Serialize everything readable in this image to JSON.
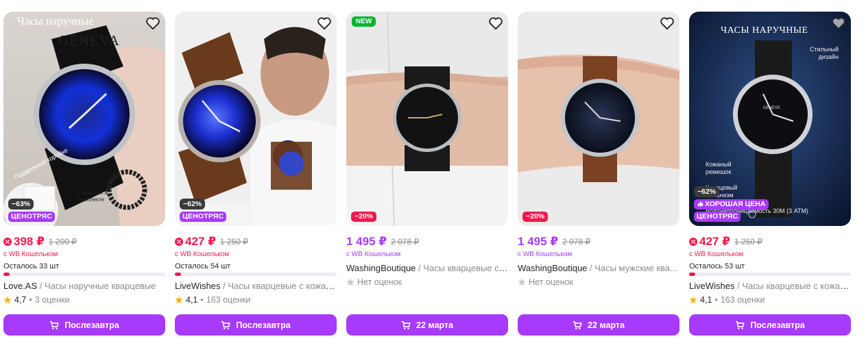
{
  "colors": {
    "accent": "#a73afd",
    "sale": "#f5174c",
    "muted": "#8b8b8b",
    "new": "#00b52b"
  },
  "icons": {
    "favorite": "heart-icon",
    "cart": "cart-icon",
    "star": "star-icon",
    "sale": "sale-icon"
  },
  "cards": [
    {
      "image_text": {
        "line1": "Часы наручные",
        "logo": "GENEVA",
        "box": "Подарочной коробке",
        "bracelet": "+ Браслет в комплекте"
      },
      "discount": "−63%",
      "cheap_badge": "ЦЕНОТРЯС",
      "price": "398 ₽",
      "old_price": "1 200 ₽",
      "wallet": "с WB Кошельком",
      "stock": "Осталось 33 шт",
      "stock_fraction": 0.04,
      "brand": "Love.AS",
      "sep": " / ",
      "name": "Часы наручные кварцевые",
      "rating": "4,7",
      "reviews": "3 оценки",
      "button": "Послезавтра"
    },
    {
      "discount": "−62%",
      "cheap_badge": "ЦЕНОТРЯС",
      "price": "427 ₽",
      "old_price": "1 250 ₽",
      "wallet": "с WB Кошельком",
      "stock": "Осталось 54 шт",
      "stock_fraction": 0.04,
      "brand": "LiveWishes",
      "sep": " / ",
      "name": "Часы кварцевые с кожан...",
      "rating": "4,1",
      "reviews": "163 оценки",
      "button": "Послезавтра"
    },
    {
      "new_badge": "NEW",
      "discount": "−20%",
      "price": "1 495 ₽",
      "old_price": "2 078 ₽",
      "wallet": "с WB Кошельком",
      "brand": "WashingBoutique",
      "sep": " / ",
      "name": "Часы кварцевые с ...",
      "no_reviews": "Нет оценок",
      "button": "22 марта"
    },
    {
      "discount": "−20%",
      "price": "1 495 ₽",
      "old_price": "2 078 ₽",
      "wallet": "с WB Кошельком",
      "brand": "WashingBoutique",
      "sep": " / ",
      "name": "Часы мужские ква...",
      "no_reviews": "Нет оценок",
      "button": "22 марта"
    },
    {
      "image_text": {
        "title": "ЧАСЫ НАРУЧНЫЕ",
        "stylish": "Стильный дизайн",
        "strap": "Кожаный ремешок",
        "quartz": "Кварцевый механизм",
        "water": "Водонепроницаемость 30М (3 АТМ)",
        "dial_brand": "GENEVE"
      },
      "discount": "−62%",
      "good_price": "ХОРОШАЯ ЦЕНА",
      "cheap_badge": "ЦЕНОТРЯС",
      "price": "427 ₽",
      "old_price": "1 250 ₽",
      "wallet": "с WB Кошельком",
      "stock": "Осталось 53 шт",
      "stock_fraction": 0.04,
      "brand": "LiveWishes",
      "sep": " / ",
      "name": "Часы кварцевые с кожан...",
      "rating": "4,1",
      "reviews": "163 оценки",
      "button": "Послезавтра"
    }
  ]
}
